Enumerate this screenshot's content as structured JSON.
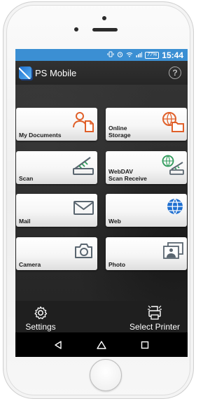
{
  "status_bar": {
    "icons": [
      "vibrate-icon",
      "alarm-icon",
      "wifi-icon",
      "signal-icon"
    ],
    "battery": "77%",
    "time": "15:44",
    "color": "#3b8fd3"
  },
  "app_bar": {
    "title": "PS Mobile",
    "help_label": "?"
  },
  "tiles": [
    {
      "id": "my-documents",
      "line1": "My Documents",
      "line2": "",
      "icon": "user-document-icon"
    },
    {
      "id": "online-storage",
      "line1": "Online",
      "line2": "Storage",
      "icon": "globe-folder-icon"
    },
    {
      "id": "scan",
      "line1": "Scan",
      "line2": "",
      "icon": "scanner-icon"
    },
    {
      "id": "webdav-scan-receive",
      "line1": "WebDAV",
      "line2": "Scan Receive",
      "icon": "globe-scanner-icon"
    },
    {
      "id": "mail",
      "line1": "Mail",
      "line2": "",
      "icon": "envelope-icon"
    },
    {
      "id": "web",
      "line1": "Web",
      "line2": "",
      "icon": "globe-icon"
    },
    {
      "id": "camera",
      "line1": "Camera",
      "line2": "",
      "icon": "camera-icon"
    },
    {
      "id": "photo",
      "line1": "Photo",
      "line2": "",
      "icon": "photo-icon"
    }
  ],
  "bottom_bar": {
    "settings_label": "Settings",
    "select_printer_label": "Select Printer"
  },
  "accent_colors": {
    "icon_orange": "#e0602a",
    "icon_blue": "#1f6fd0",
    "icon_green": "#2f9a5a",
    "icon_gray": "#5a6670"
  }
}
